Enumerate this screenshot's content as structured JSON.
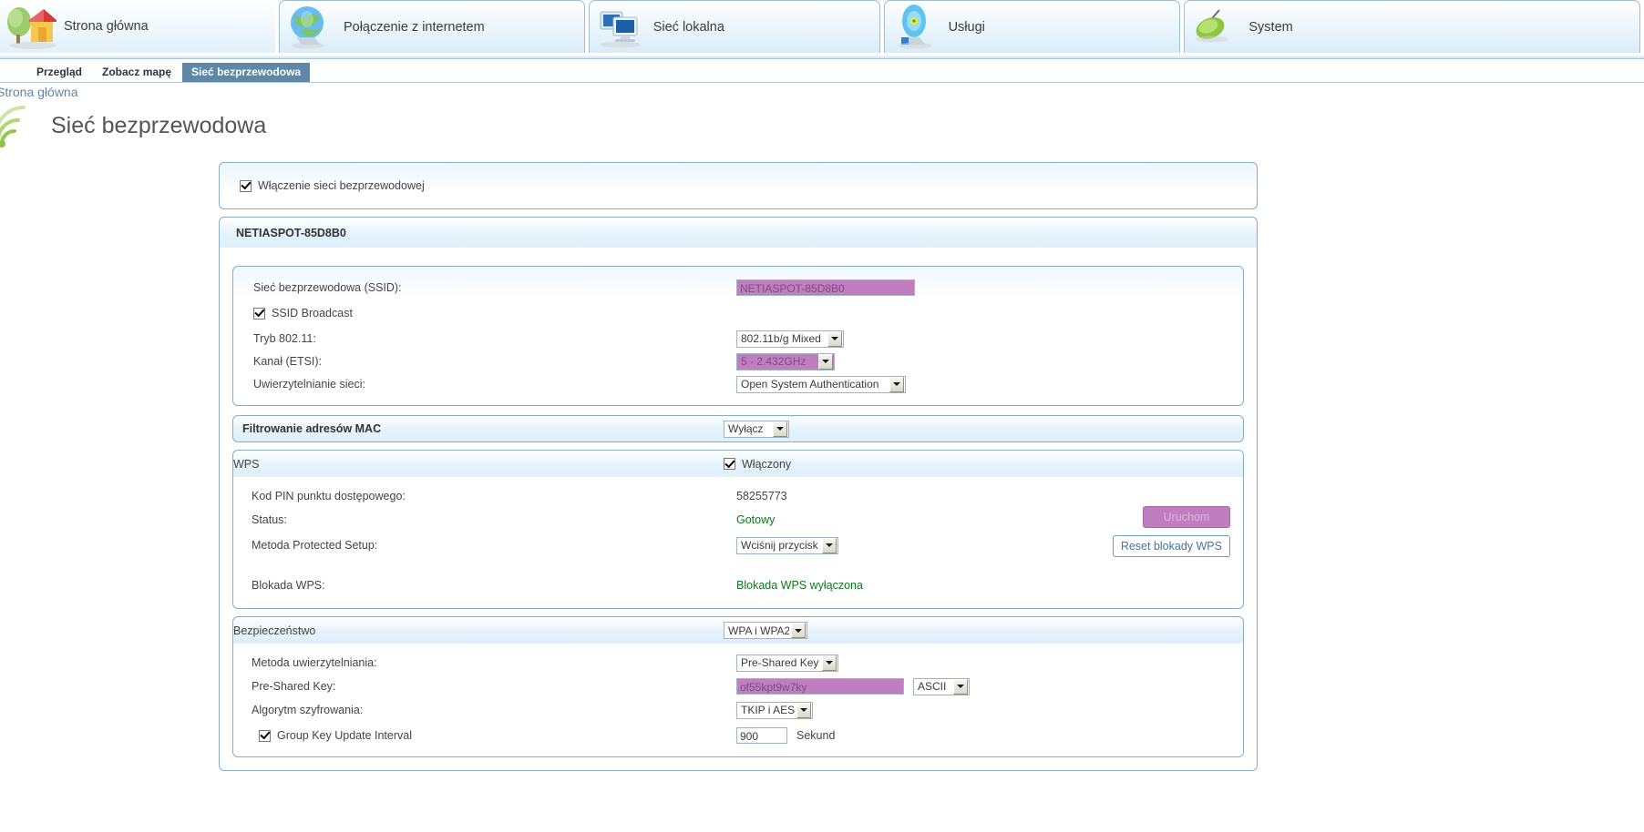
{
  "topnav": [
    {
      "label": "Strona główna",
      "icon": "house-tree-icon"
    },
    {
      "label": "Połączenie z internetem",
      "icon": "globe-icon"
    },
    {
      "label": "Sieć lokalna",
      "icon": "two-monitors-icon"
    },
    {
      "label": "Usługi",
      "icon": "blue-disc-icon"
    },
    {
      "label": "System",
      "icon": "green-gear-icon"
    }
  ],
  "subnav": [
    {
      "label": "Przegląd",
      "active": false
    },
    {
      "label": "Zobacz mapę",
      "active": false
    },
    {
      "label": "Sieć bezprzewodowa",
      "active": true
    }
  ],
  "breadcrumb": "Strona główna",
  "page": {
    "title": "Sieć bezprzewodowa",
    "icon": "wifi-signal-icon"
  },
  "enable_panel": {
    "checkbox_label": "Włączenie sieci bezprzewodowej",
    "checked": true
  },
  "ssid_group": {
    "header": "NETIASPOT-85D8B0",
    "rows": {
      "ssid_label": "Sieć bezprzewodowa (SSID):",
      "ssid_value": "NETIASPOT-85D8B0",
      "broadcast_label": "SSID Broadcast",
      "mode_label": "Tryb 802.11:",
      "mode_value": "802.11b/g Mixed",
      "channel_label": "Kanał (ETSI):",
      "channel_value": "5 - 2.432GHz",
      "auth_label": "Uwierzytelnianie sieci:",
      "auth_value": "Open System Authentication"
    }
  },
  "mac_filter": {
    "title": "Filtrowanie adresów MAC",
    "value": "Wyłącz"
  },
  "wps": {
    "title": "WPS",
    "enabled_label": "Włączony",
    "enabled": true,
    "pin_label": "Kod PIN punktu dostępowego:",
    "pin_value": "58255773",
    "status_label": "Status:",
    "status_value": "Gotowy",
    "method_label": "Metoda Protected Setup:",
    "method_value": "Wciśnij przycisk",
    "start_button": "Uruchom",
    "lock_label": "Blokada WPS:",
    "lock_value": "Blokada WPS wyłączona",
    "reset_button": "Reset blokady WPS"
  },
  "security": {
    "title": "Bezpieczeństwo",
    "mode_value": "WPA i WPA2",
    "auth_method_label": "Metoda uwierzytelniania:",
    "auth_method_value": "Pre-Shared Key",
    "psk_label": "Pre-Shared Key:",
    "psk_value": "of55kpt9w7ky",
    "psk_format": "ASCII",
    "cipher_label": "Algorytm szyfrowania:",
    "cipher_value": "TKIP i AES",
    "gku_label": "Group Key Update Interval",
    "gku_checked": true,
    "gku_value": "900",
    "gku_unit": "Sekund"
  },
  "colors": {
    "accent_blue": "#5e87a8",
    "panel_border": "#8aadc6",
    "autofill_purple": "#c07dc0",
    "status_green": "#0a7a18",
    "link_blue": "#3f77a3"
  }
}
